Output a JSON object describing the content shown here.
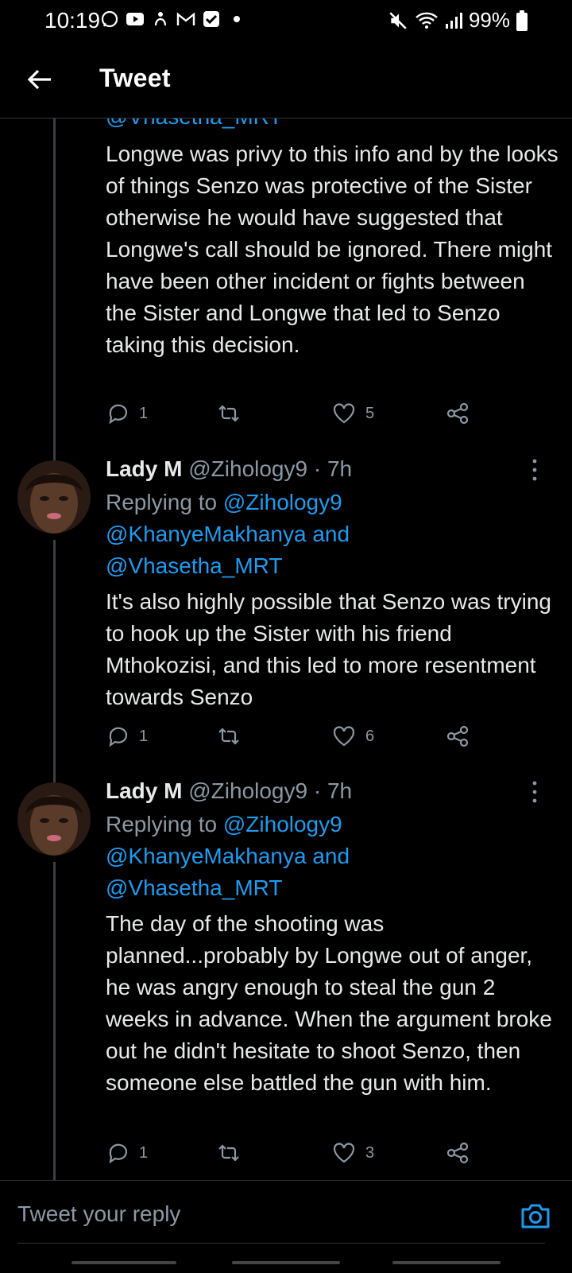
{
  "status_bar": {
    "time": "10:19",
    "battery": "99%"
  },
  "header": {
    "title": "Tweet"
  },
  "first_tweet": {
    "partial_mention": "@Vhasetha_MRT",
    "text": "Longwe was privy to this info and by the looks of things Senzo was protective of the Sister otherwise he would have suggested that Longwe's call should be ignored. There might have been other incident or fights between the Sister and Longwe that led to Senzo taking this decision.",
    "replies": "1",
    "likes": "5"
  },
  "tweets": [
    {
      "name": "Lady M",
      "handle": "@Zihology9 · 7h",
      "replying_prefix": "Replying to",
      "replying_to_1": "@Zihology9",
      "replying_to_2": "@KhanyeMakhanya and",
      "replying_to_3": "@Vhasetha_MRT",
      "text": "It's also highly possible that Senzo was trying to hook up the Sister with his friend Mthokozisi, and this led to more resentment towards Senzo",
      "replies": "1",
      "likes": "6"
    },
    {
      "name": "Lady M",
      "handle": "@Zihology9 · 7h",
      "replying_prefix": "Replying to",
      "replying_to_1": "@Zihology9",
      "replying_to_2": "@KhanyeMakhanya and",
      "replying_to_3": "@Vhasetha_MRT",
      "text": "The day of the shooting was planned...probably by Longwe out of anger, he was angry enough to steal the gun 2 weeks in advance. When the argument broke out he didn't hesitate to shoot Senzo, then someone else battled the gun with him.",
      "replies": "1",
      "likes": "3"
    }
  ],
  "reply_bar": {
    "placeholder": "Tweet your reply"
  },
  "icons": {
    "reply": "reply-icon",
    "retweet": "retweet-icon",
    "like": "heart-icon",
    "share": "share-icon",
    "back": "back-arrow-icon",
    "camera": "camera-icon",
    "more": "more-icon"
  }
}
